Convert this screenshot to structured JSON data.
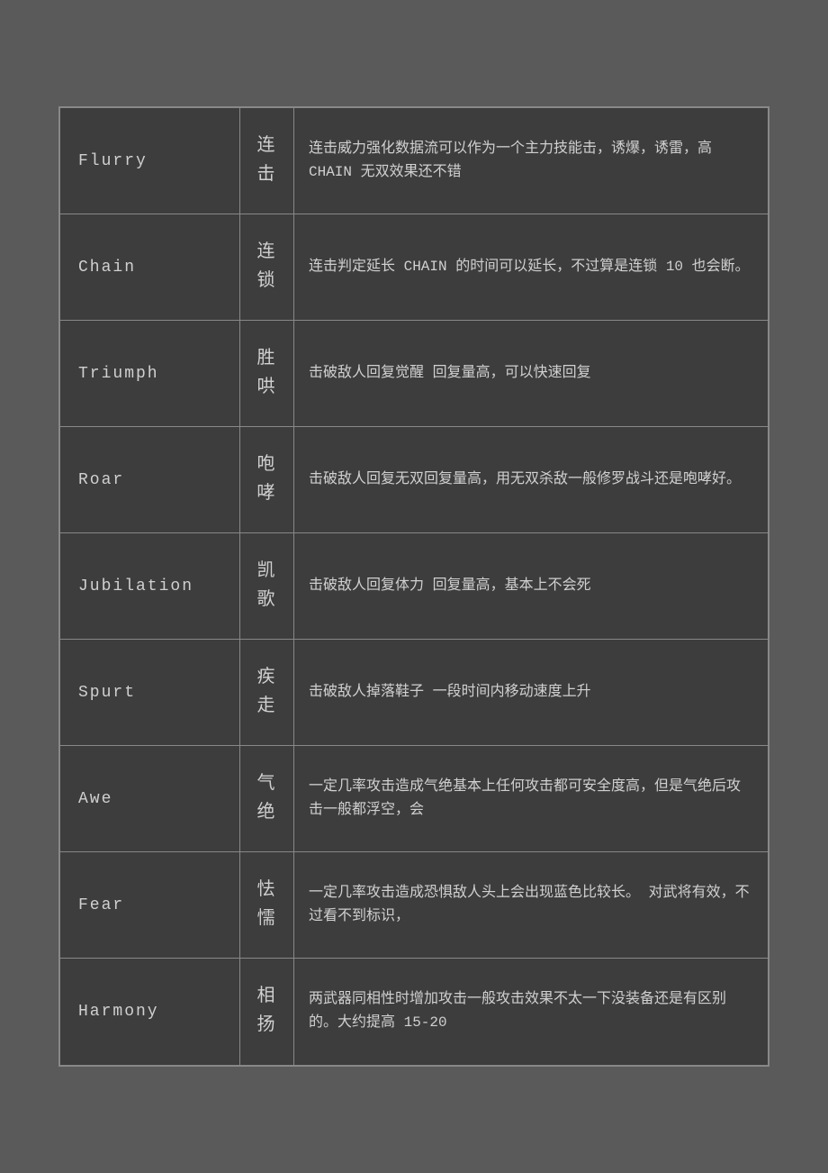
{
  "table": {
    "rows": [
      {
        "id": "flurry",
        "name": "Flurry",
        "chinese": "连击",
        "description": "连击威力强化数据流可以作为一个主力技能击，诱爆，诱雷，高 CHAIN 无双效果还不错"
      },
      {
        "id": "chain",
        "name": "Chain",
        "chinese": "连锁",
        "description": "连击判定延长 CHAIN 的时间可以延长，不过算是连锁 10 也会断。"
      },
      {
        "id": "triumph",
        "name": "Triumph",
        "chinese": "胜哄",
        "description": "击破敌人回复觉醒  回复量高，可以快速回复"
      },
      {
        "id": "roar",
        "name": "Roar",
        "chinese": "咆哮",
        "description": "击破敌人回复无双回复量高，用无双杀敌一般修罗战斗还是咆哮好。"
      },
      {
        "id": "jubilation",
        "name": "Jubilation",
        "chinese": "凯歌",
        "description": "击破敌人回复体力  回复量高，基本上不会死"
      },
      {
        "id": "spurt",
        "name": "Spurt",
        "chinese": "疾走",
        "description": "击破敌人掉落鞋子  一段时间内移动速度上升"
      },
      {
        "id": "awe",
        "name": "Awe",
        "chinese": "气绝",
        "description": "一定几率攻击造成气绝基本上任何攻击都可安全度高，但是气绝后攻击一般都浮空，会"
      },
      {
        "id": "fear",
        "name": "Fear",
        "chinese": "怯懦",
        "description": "一定几率攻击造成恐惧敌人头上会出现蓝色比较长。  对武将有效，不过看不到标识，"
      },
      {
        "id": "harmony",
        "name": "Harmony",
        "chinese": "相扬",
        "description": "两武器同相性时增加攻击一般攻击效果不太一下没装备还是有区别的。大约提高 15-20"
      }
    ]
  }
}
